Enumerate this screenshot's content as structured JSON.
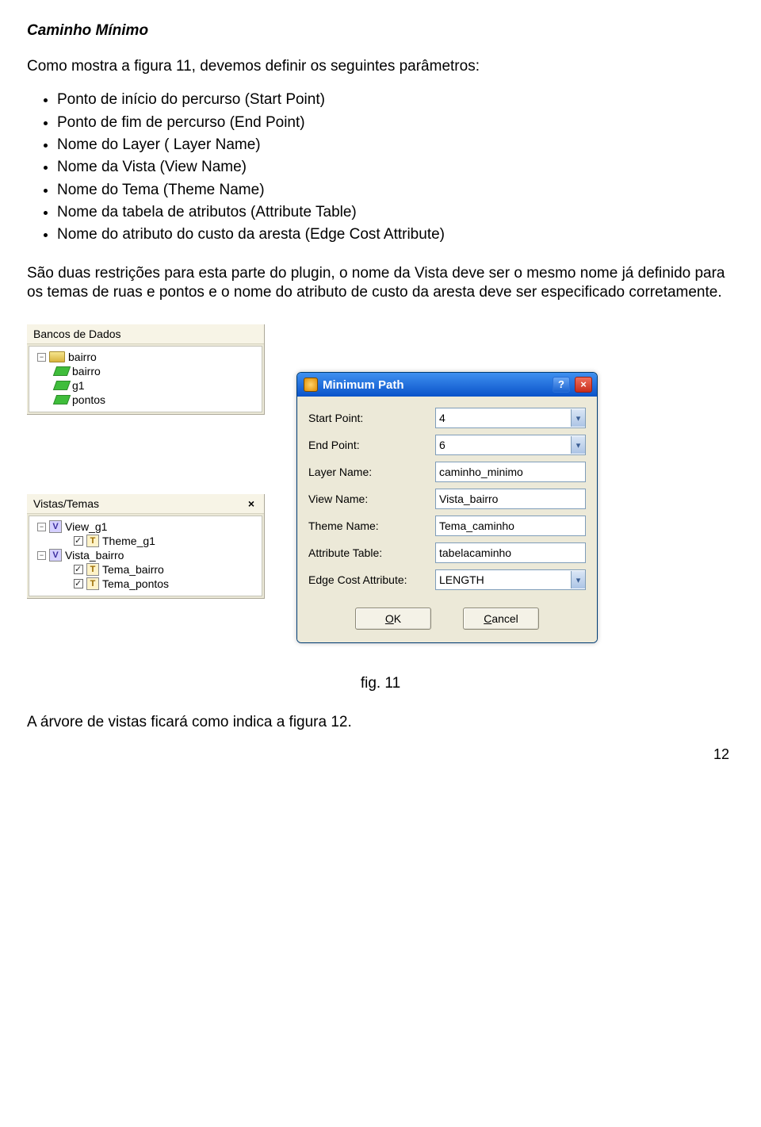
{
  "heading": "Caminho Mínimo",
  "intro": "Como mostra a figura 11, devemos definir os seguintes parâmetros:",
  "bullets": [
    "Ponto de início do percurso (Start Point)",
    "Ponto de fim de percurso (End Point)",
    "Nome do Layer ( Layer Name)",
    "Nome da Vista (View Name)",
    "Nome do Tema (Theme Name)",
    "Nome da tabela de atributos (Attribute Table)",
    "Nome do atributo do custo da aresta (Edge Cost Attribute)"
  ],
  "restrictions": "São duas restrições para esta parte do plugin, o nome da Vista deve ser o mesmo nome já definido para os temas de ruas e pontos e o nome do atributo de custo da aresta deve ser especificado corretamente.",
  "db_tree": {
    "title": "Bancos de Dados",
    "root": "bairro",
    "children": [
      "bairro",
      "g1",
      "pontos"
    ]
  },
  "views_tree": {
    "title": "Vistas/Temas",
    "close": "×",
    "items": [
      {
        "type": "view",
        "label": "View_g1",
        "children": [
          {
            "label": "Theme_g1"
          }
        ]
      },
      {
        "type": "view",
        "label": "Vista_bairro",
        "children": [
          {
            "label": "Tema_bairro"
          },
          {
            "label": "Tema_pontos"
          }
        ]
      }
    ]
  },
  "dialog": {
    "title": "Minimum Path",
    "help": "?",
    "close": "×",
    "rows": [
      {
        "label": "Start Point:",
        "value": "4",
        "dropdown": true
      },
      {
        "label": "End Point:",
        "value": "6",
        "dropdown": true
      },
      {
        "label": "Layer Name:",
        "value": "caminho_minimo",
        "dropdown": false
      },
      {
        "label": "View Name:",
        "value": "Vista_bairro",
        "dropdown": false
      },
      {
        "label": "Theme Name:",
        "value": "Tema_caminho",
        "dropdown": false
      },
      {
        "label": "Attribute Table:",
        "value": "tabelacaminho",
        "dropdown": false
      },
      {
        "label": "Edge Cost Attribute:",
        "value": "LENGTH",
        "dropdown": true
      }
    ],
    "ok_u": "O",
    "ok_rest": "K",
    "cancel_u": "C",
    "cancel_rest": "ancel"
  },
  "caption": "fig. 11",
  "closing": "A árvore de vistas ficará como indica a figura 12.",
  "page": "12"
}
